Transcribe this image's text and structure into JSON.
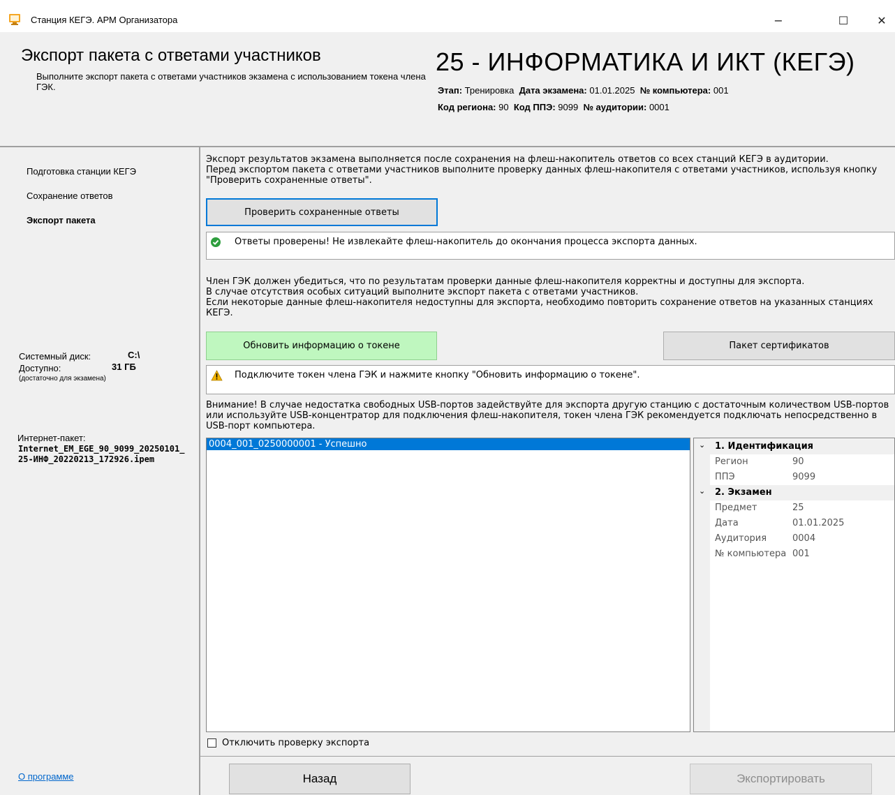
{
  "window": {
    "title": "Станция КЕГЭ. АРМ Организатора",
    "minimize": "−",
    "maximize": "☐",
    "close": "✕"
  },
  "header": {
    "title": "Экспорт пакета с ответами участников",
    "subtitle": "Выполните экспорт пакета с ответами участников экзамена с использованием токена члена ГЭК.",
    "subject": "25 - ИНФОРМАТИКА И ИКТ (КЕГЭ)",
    "stage_label": "Этап:",
    "stage_value": "Тренировка",
    "date_label": "Дата экзамена:",
    "date_value": "01.01.2025",
    "computer_label": "№ компьютера:",
    "computer_value": "001",
    "region_label": "Код региона:",
    "region_value": "90",
    "ppe_label": "Код ППЭ:",
    "ppe_value": "9099",
    "room_label": "№ аудитории:",
    "room_value": "0001"
  },
  "sidebar": {
    "items": [
      {
        "label": "Подготовка станции КЕГЭ",
        "active": false
      },
      {
        "label": "Сохранение ответов",
        "active": false
      },
      {
        "label": "Экспорт пакета",
        "active": true
      }
    ],
    "disk_label": "Системный диск:",
    "disk_value": "C:\\",
    "available_label": "Доступно:",
    "available_value": "31 ГБ",
    "available_note": "(достаточно для экзамена)",
    "package_label": "Интернет-пакет:",
    "package_value": "Internet_EM_EGE_90_9099_20250101_25-ИНФ_20220213_172926.ipem",
    "about_link": "О программе"
  },
  "main": {
    "intro": "Экспорт результатов экзамена выполняется после сохранения на флеш-накопитель ответов со всех станций КЕГЭ в аудитории.\nПеред экспортом пакета с ответами участников выполните проверку данных флеш-накопителя с ответами участников, используя кнопку \"Проверить сохраненные ответы\".",
    "check_button": "Проверить сохраненные ответы",
    "check_message": "Ответы проверены! Не извлекайте флеш-накопитель до окончания процесса экспорта данных.",
    "gek_text": "Член ГЭК должен убедиться, что по результатам проверки данные флеш-накопителя корректны и доступны для экспорта.\nВ случае отсутствия особых ситуаций выполните экспорт пакета с ответами участников.\nЕсли некоторые данные флеш-накопителя недоступны для экспорта, необходимо повторить сохранение ответов на указанных станциях КЕГЭ.",
    "refresh_token_button": "Обновить информацию о токене",
    "certificates_button": "Пакет сертификатов",
    "token_message": "Подключите токен члена ГЭК и нажмите кнопку \"Обновить информацию о токене\".",
    "warning_text": "Внимание! В случае недостатка свободных USB-портов задействуйте для экспорта другую станцию с достаточным количеством USB-портов или используйте USB-концентратор для подключения флеш-накопителя, токен члена ГЭК рекомендуется подключать непосредственно в USB-порт компьютера.",
    "list_items": [
      "0004_001_0250000001 - Успешно"
    ],
    "properties": {
      "group1": "1. Идентификация",
      "region_key": "Регион",
      "region_val": "90",
      "ppe_key": "ППЭ",
      "ppe_val": "9099",
      "group2": "2. Экзамен",
      "subject_key": "Предмет",
      "subject_val": "25",
      "date_key": "Дата",
      "date_val": "01.01.2025",
      "room_key": "Аудитория",
      "room_val": "0004",
      "computer_key": "№ компьютера",
      "computer_val": "001"
    },
    "disable_check_label": "Отключить проверку экспорта",
    "back_button": "Назад",
    "export_button": "Экспортировать"
  }
}
